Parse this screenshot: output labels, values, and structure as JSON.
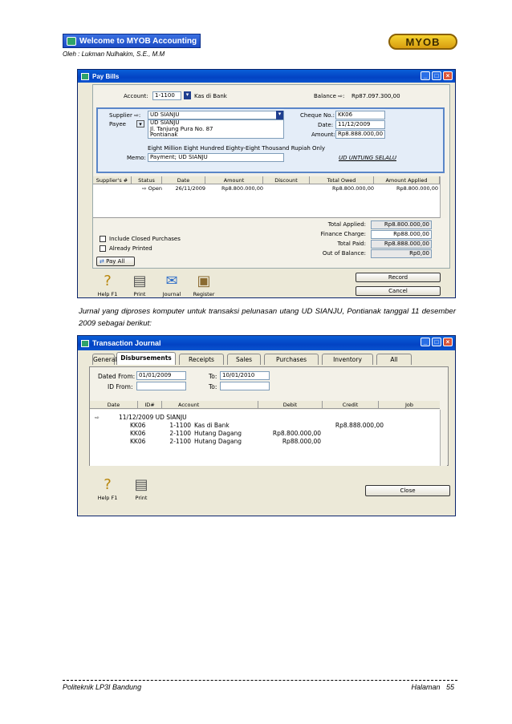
{
  "header": {
    "banner_title": "Welcome to MYOB Accounting",
    "author": "Oleh : Lukman Nulhakim, S.E., M.M",
    "logo_text": "MYOB"
  },
  "pay_bills": {
    "title": "Pay Bills",
    "account_label": "Account:",
    "account_no": "1-1100",
    "account_name": "Kas di Bank",
    "balance_label": "Balance ⇨:",
    "balance_value": "Rp87.097.300,00",
    "supplier_label": "Supplier ⇨:",
    "supplier_value": "UD SIANJU",
    "payee_label": "Payee",
    "payee_lines": [
      "UD SIANJU",
      "Jl. Tanjung Pura No. 87",
      "Pontianak"
    ],
    "cheque_label": "Cheque No.:",
    "cheque_value": "KK06",
    "date_label": "Date:",
    "date_value": "11/12/2009",
    "amount_label": "Amount:",
    "amount_value": "Rp8.888.000,00",
    "amount_words": "Eight Million Eight Hundred Eighty-Eight Thousand Rupiah  Only",
    "memo_label": "Memo:",
    "memo_value": "Payment; UD SIANJU",
    "signature": "UD UNTUNG SELALU",
    "columns": [
      "Supplier's #",
      "Status",
      "Date",
      "Amount",
      "Discount",
      "Total Owed",
      "Amount Applied"
    ],
    "row": {
      "supplier_no": "",
      "status": "⇨ Open",
      "date": "26/11/2009",
      "amount": "Rp8.800.000,00",
      "discount": "",
      "total_owed": "Rp8.800.000,00",
      "amount_applied": "Rp8.800.000,00"
    },
    "totals": [
      {
        "label": "Total Applied:",
        "value": "Rp8.800.000,00"
      },
      {
        "label": "Finance Charge:",
        "value": "Rp88.000,00"
      },
      {
        "label": "Total Paid:",
        "value": "Rp8.888.000,00"
      },
      {
        "label": "Out of Balance:",
        "value": "Rp0,00"
      }
    ],
    "include_closed": "Include Closed Purchases",
    "already_printed": "Already Printed",
    "pay_all": "Pay All",
    "tools": [
      "Help F1",
      "Print",
      "Journal",
      "Register"
    ],
    "record_button": "Record",
    "cancel_button": "Cancel"
  },
  "paragraph": "Jurnal yang diproses komputer  untuk transaksi pelunasan utang UD SIANJU, Pontianak tanggal 11 desember 2009 sebagai berikut:",
  "journal": {
    "title": "Transaction Journal",
    "tabs": [
      "General",
      "Disbursements",
      "Receipts",
      "Sales",
      "Purchases",
      "Inventory",
      "All"
    ],
    "active_tab": "Disbursements",
    "dated_from_label": "Dated From:",
    "dated_from": "01/01/2009",
    "to_label": "To:",
    "to_value": "10/01/2010",
    "id_from_label": "ID From:",
    "id_to_label": "To:",
    "columns": [
      "Date",
      "ID#",
      "Account",
      "Debit",
      "Credit",
      "Job"
    ],
    "entry_header": "11/12/2009  UD SIANJU",
    "rows": [
      {
        "id": "KK06",
        "acc_no": "1-1100",
        "account": "Kas di Bank",
        "debit": "",
        "credit": "Rp8.888.000,00"
      },
      {
        "id": "KK06",
        "acc_no": "2-1100",
        "account": "Hutang Dagang",
        "debit": "Rp8.800.000,00",
        "credit": ""
      },
      {
        "id": "KK06",
        "acc_no": "2-1100",
        "account": "Hutang Dagang",
        "debit": "Rp88.000,00",
        "credit": ""
      }
    ],
    "tools": [
      "Help F1",
      "Print"
    ],
    "close_button": "Close"
  },
  "footer": {
    "left": "Politeknik LP3I Bandung",
    "right": "Halaman   55"
  }
}
